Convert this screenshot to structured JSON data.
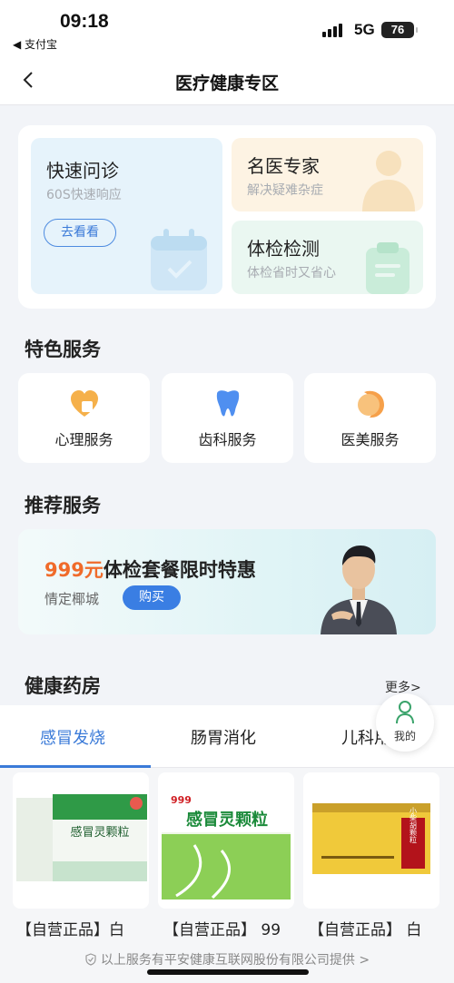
{
  "status": {
    "time": "09:18",
    "back_app": "◀ 支付宝",
    "network": "5G",
    "battery": "76"
  },
  "nav": {
    "title": "医疗健康专区"
  },
  "quick_entries": {
    "consult": {
      "title": "快速问诊",
      "subtitle": "60S快速响应",
      "button": "去看看"
    },
    "expert": {
      "title": "名医专家",
      "subtitle": "解决疑难杂症"
    },
    "checkup": {
      "title": "体检检测",
      "subtitle": "体检省时又省心"
    }
  },
  "featured": {
    "title": "特色服务",
    "items": [
      {
        "label": "心理服务",
        "icon": "heart-icon"
      },
      {
        "label": "齿科服务",
        "icon": "tooth-icon"
      },
      {
        "label": "医美服务",
        "icon": "face-icon"
      }
    ]
  },
  "recommend": {
    "title": "推荐服务",
    "promo_price": "999元",
    "promo_text": "体检套餐限时特惠",
    "promo_place": "情定椰城",
    "buy_button": "购买"
  },
  "pharmacy": {
    "title": "健康药房",
    "more": "更多>",
    "tabs": [
      "感冒发烧",
      "肠胃消化",
      "儿科用"
    ],
    "products": [
      {
        "name": "【自营正品】白",
        "box_label": "感冒灵颗粒"
      },
      {
        "name": "【自营正品】 99",
        "brand": "999",
        "box_label": "感冒灵颗粒"
      },
      {
        "name": "【自营正品】 白",
        "box_label": "小柴胡颗粒"
      }
    ]
  },
  "floating": {
    "mine_label": "我的"
  },
  "footer": {
    "note": "以上服务有平安健康互联网股份有限公司提供 >"
  },
  "colors": {
    "accent": "#3a7ad8",
    "price": "#f06b2a",
    "page_bg": "#f2f4f8"
  }
}
